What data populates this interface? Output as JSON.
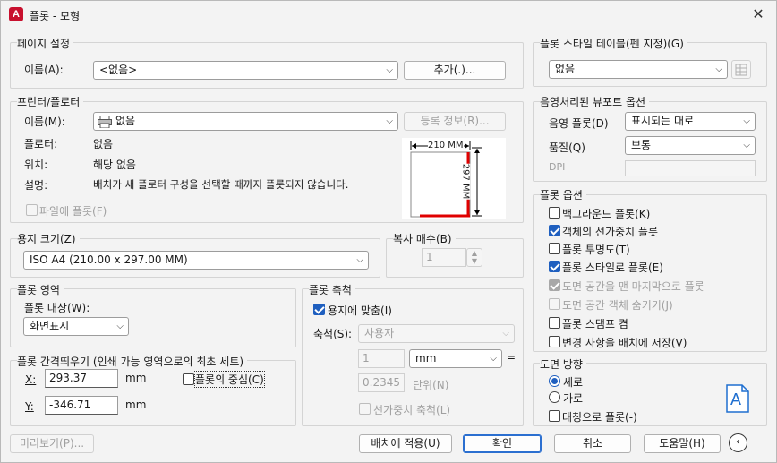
{
  "window": {
    "title": "플롯 - 모형",
    "app_icon_letter": "A"
  },
  "page_setup": {
    "group_title": "페이지 설정",
    "name_label": "이름(A):",
    "name_value": "<없음>",
    "add_button": "추가(.)..."
  },
  "printer": {
    "group_title": "프린터/플로터",
    "name_label": "이름(M):",
    "name_value": "없음",
    "properties_button": "등록 정보(R)...",
    "plotter_label": "플로터:",
    "plotter_value": "없음",
    "location_label": "위치:",
    "location_value": "해당 없음",
    "description_label": "설명:",
    "description_value": "배치가 새 플로터 구성을 선택할 때까지 플롯되지 않습니다.",
    "plot_to_file_label": "파일에 플롯(F)",
    "preview_width": "210  MM",
    "preview_height": "297  MM"
  },
  "paper_size": {
    "group_title": "용지 크기(Z)",
    "value": "ISO A4 (210.00 x 297.00 MM)"
  },
  "copies": {
    "group_title": "복사 매수(B)",
    "value": "1"
  },
  "plot_area": {
    "group_title": "플롯 영역",
    "what_label": "플롯 대상(W):",
    "what_value": "화면표시"
  },
  "plot_offset": {
    "group_title": "플롯 간격띄우기 (인쇄 가능 영역으로의 최초 세트)",
    "x_label": "X:",
    "x_value": "293.37",
    "x_unit": "mm",
    "y_label": "Y:",
    "y_value": "-346.71",
    "y_unit": "mm",
    "center_label": "플롯의 중심(C)"
  },
  "plot_scale": {
    "group_title": "플롯 축척",
    "fit_label": "용지에 맞춤(I)",
    "scale_label": "축척(S):",
    "scale_value": "사용자",
    "value1": "1",
    "unit_value": "mm",
    "equals": "=",
    "value2": "0.2345",
    "units_label": "단위(N)",
    "lineweight_label": "선가중치 축척(L)"
  },
  "plot_style_table": {
    "group_title": "플롯 스타일 테이블(펜 지정)(G)",
    "value": "없음"
  },
  "shaded_viewport": {
    "group_title": "음영처리된 뷰포트 옵션",
    "shade_label": "음영 플롯(D)",
    "shade_value": "표시되는 대로",
    "quality_label": "품질(Q)",
    "quality_value": "보통",
    "dpi_label": "DPI"
  },
  "plot_options": {
    "group_title": "플롯 옵션",
    "items": [
      {
        "label": "백그라운드 플롯(K)"
      },
      {
        "label": "객체의 선가중치 플롯"
      },
      {
        "label": "플롯 투명도(T)"
      },
      {
        "label": "플롯 스타일로 플롯(E)"
      },
      {
        "label": "도면 공간을 맨 마지막으로 플롯"
      },
      {
        "label": "도면 공간 객체 숨기기(J)"
      },
      {
        "label": "플롯 스탬프 켬"
      },
      {
        "label": "변경 사항을 배치에 저장(V)"
      }
    ]
  },
  "orientation": {
    "group_title": "도면 방향",
    "portrait_label": "세로",
    "landscape_label": "가로",
    "upside_down_label": "대칭으로 플롯(-)",
    "icon_letter": "A"
  },
  "footer": {
    "preview_button": "미리보기(P)...",
    "apply_button": "배치에 적용(U)",
    "ok_button": "확인",
    "cancel_button": "취소",
    "help_button": "도움말(H)"
  },
  "colors": {
    "accent": "#1f5fbf",
    "paper_margin": "#e00000",
    "app_icon": "#c8102e"
  }
}
